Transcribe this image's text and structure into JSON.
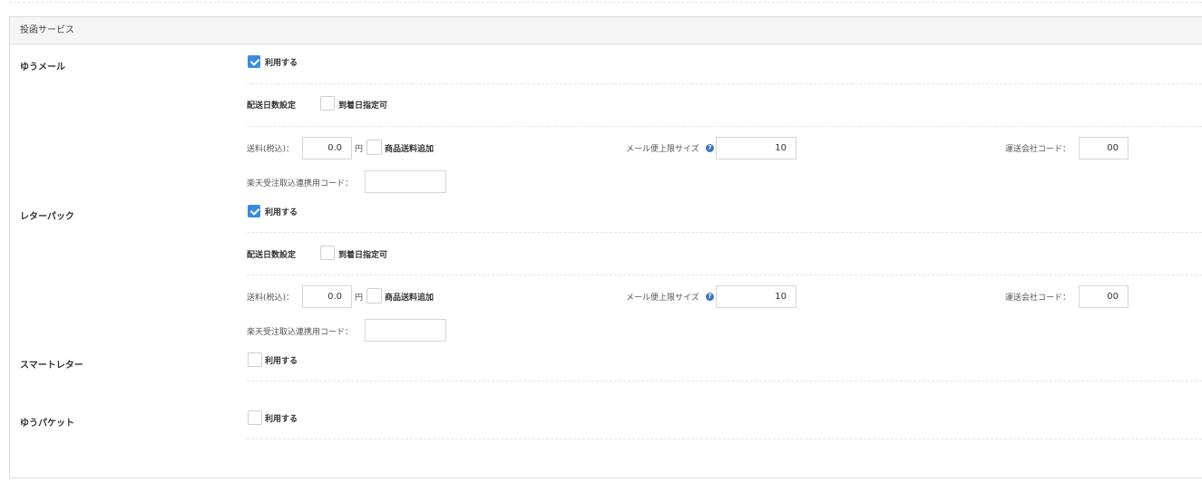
{
  "panel": {
    "title": "投函サービス"
  },
  "services": [
    {
      "name": "ゆうメール",
      "use_label": "利用する",
      "use_checked": true,
      "delivery_days_label": "配送日数設定",
      "arrival_date_label": "到着日指定可",
      "arrival_date_checked": false,
      "shipping_fee_label": "送料(税込)：",
      "shipping_fee_value": "0.0",
      "yen_label": "円",
      "add_product_fee_label": "商品送料追加",
      "mail_size_label": "メール便上限サイズ",
      "mail_size_value": "10",
      "carrier_code_label": "運送会社コード：",
      "carrier_code_value": "00",
      "rakuten_code_label": "楽天受注取込連携用コード：",
      "rakuten_code_value": ""
    },
    {
      "name": "レターパック",
      "use_label": "利用する",
      "use_checked": true,
      "delivery_days_label": "配送日数設定",
      "arrival_date_label": "到着日指定可",
      "arrival_date_checked": false,
      "shipping_fee_label": "送料(税込)：",
      "shipping_fee_value": "0.0",
      "yen_label": "円",
      "add_product_fee_label": "商品送料追加",
      "mail_size_label": "メール便上限サイズ",
      "mail_size_value": "10",
      "carrier_code_label": "運送会社コード：",
      "carrier_code_value": "00",
      "rakuten_code_label": "楽天受注取込連携用コード：",
      "rakuten_code_value": ""
    },
    {
      "name": "スマートレター",
      "use_label": "利用する",
      "use_checked": false
    },
    {
      "name": "ゆうパケット",
      "use_label": "利用する",
      "use_checked": false
    }
  ],
  "colors": {
    "accent": "#3b8bd9",
    "header_bg": "#f5f5f5",
    "border": "#dcdcdc"
  },
  "icons": {
    "help": "question-circle-icon",
    "check": "checkmark-icon"
  }
}
